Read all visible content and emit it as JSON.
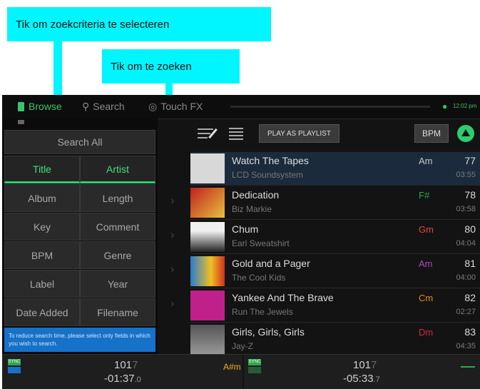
{
  "callouts": {
    "criteria": "Tik om zoekcriteria te selecteren",
    "search": "Tik om te zoeken"
  },
  "topbar": {
    "browse": "Browse",
    "search": "Search",
    "touchfx": "Touch FX",
    "time": "12:02 pm"
  },
  "panel": {
    "search_all": "Search All",
    "fields": [
      [
        "Title",
        "Artist"
      ],
      [
        "Album",
        "Length"
      ],
      [
        "Key",
        "Comment"
      ],
      [
        "BPM",
        "Genre"
      ],
      [
        "Label",
        "Year"
      ],
      [
        "Date Added",
        "Filename"
      ]
    ],
    "hint": "To reduce search time, please select only fields in which you wish to search."
  },
  "toolbar": {
    "play_as_playlist": "PLAY AS PLAYLIST",
    "bpm": "BPM"
  },
  "tracks": [
    {
      "title": "Watch The Tapes",
      "artist": "LCD Soundsystem",
      "key": "Am",
      "key_color": "#c8c8c8",
      "bpm": "77",
      "length": "03:55"
    },
    {
      "title": "Dedication",
      "artist": "Biz Markie",
      "key": "F#",
      "key_color": "#2fa84f",
      "bpm": "78",
      "length": "03:58"
    },
    {
      "title": "Chum",
      "artist": "Earl Sweatshirt",
      "key": "Gm",
      "key_color": "#e0483a",
      "bpm": "80",
      "length": "04:04"
    },
    {
      "title": "Gold and a Pager",
      "artist": "The Cool Kids",
      "key": "Am",
      "key_color": "#b04bc0",
      "bpm": "81",
      "length": "04:00"
    },
    {
      "title": "Yankee And The Brave",
      "artist": "Run The Jewels",
      "key": "Cm",
      "key_color": "#e08a22",
      "bpm": "82",
      "length": "02:27"
    },
    {
      "title": "Girls, Girls, Girls",
      "artist": "Jay-Z",
      "key": "Dm",
      "key_color": "#d0283c",
      "bpm": "83",
      "length": "04:35"
    }
  ],
  "bottom": {
    "deck1_bpm": "101",
    "deck1_bpm_dec": "7",
    "deck1_time": "-01:37",
    "deck1_time_dec": ".0",
    "deck1_key": "A#m",
    "deck2_bpm": "101",
    "deck2_bpm_dec": "7",
    "deck2_time": "-05:33",
    "deck2_time_dec": ".7",
    "sync": "SYNC"
  },
  "colors": {
    "accent": "#2ecc71",
    "callout": "#00f6ff",
    "hint": "#1671c9"
  }
}
